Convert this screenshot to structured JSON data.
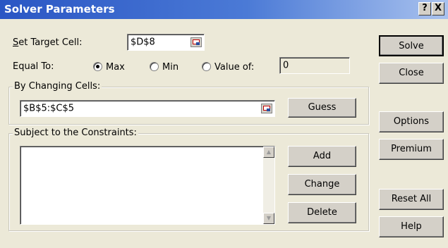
{
  "window": {
    "title": "Solver Parameters",
    "help_label": "?",
    "close_label": "X"
  },
  "target": {
    "label": "Set Target Cell:",
    "value": "$D$8"
  },
  "equal_to": {
    "label": "Equal To:",
    "max_label": "Max",
    "min_label": "Min",
    "value_of_label": "Value of:",
    "value": "0",
    "selected": "max"
  },
  "changing": {
    "label": "By Changing Cells:",
    "value": "$B$5:$C$5",
    "guess_label": "Guess"
  },
  "constraints": {
    "label": "Subject to the Constraints:",
    "add_label": "Add",
    "change_label": "Change",
    "delete_label": "Delete"
  },
  "buttons": {
    "solve": "Solve",
    "close": "Close",
    "options": "Options",
    "premium": "Premium",
    "reset_all": "Reset All",
    "help": "Help"
  },
  "colors": {
    "title_bar_start": "#2a56c4",
    "title_bar_end": "#a9c2ee",
    "dialog_bg": "#ece9d8"
  }
}
